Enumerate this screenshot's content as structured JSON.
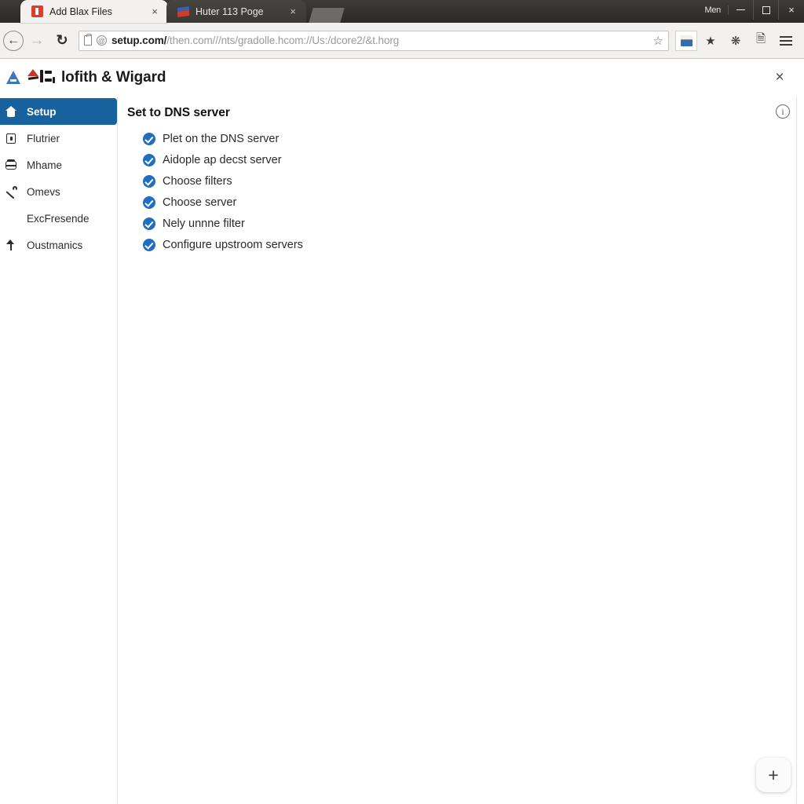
{
  "browser": {
    "tabs": [
      {
        "title": "Add Blax Files",
        "favicon": "red-document-icon",
        "active": true,
        "close_label": "×"
      },
      {
        "title": "Huter 113 Poge",
        "favicon": "flag-icon",
        "active": false,
        "close_label": "×"
      }
    ],
    "window_menu_label": "Men",
    "window_controls": {
      "minimize": "–",
      "maximize": "□",
      "close": "×"
    },
    "nav": {
      "back": "←",
      "forward": "→",
      "reload": "↻"
    },
    "omnibox": {
      "url_host": "setup.com/",
      "url_rest": "/then.com///nts/gradolle.hcom://Us:/dcore2/&t.horg",
      "star": "☆"
    },
    "toolbar_icons": [
      "star-icon",
      "dark-star-icon",
      "puzzle-icon",
      "contact-card-icon",
      "menu-icon"
    ]
  },
  "app": {
    "logo_name": "adguard-logo",
    "title": "lofith & Wigard",
    "close_label": "×"
  },
  "sidebar": {
    "items": [
      {
        "label": "Setup",
        "icon": "home-icon",
        "active": true
      },
      {
        "label": "Flutrier",
        "icon": "lock-icon",
        "active": false
      },
      {
        "label": "Mhame",
        "icon": "database-icon",
        "active": false
      },
      {
        "label": "Omevs",
        "icon": "wrench-icon",
        "active": false
      },
      {
        "label": "ExcFresende",
        "icon": "none",
        "active": false
      },
      {
        "label": "Oustmanics",
        "icon": "up-arrow-icon",
        "active": false
      }
    ]
  },
  "main": {
    "heading": "Set to DNS server",
    "info_icon_label": "i",
    "checklist": [
      {
        "label": "Plet on the DNS server",
        "checked": true
      },
      {
        "label": "Aidople ap decst server",
        "checked": true
      },
      {
        "label": "Choose filters",
        "checked": true
      },
      {
        "label": "Choose server",
        "checked": true
      },
      {
        "label": "Nely unnne filter",
        "checked": true
      },
      {
        "label": "Configure upstroom servers",
        "checked": true
      }
    ],
    "fab_label": "+"
  },
  "colors": {
    "accent_blue": "#18619f",
    "check_blue": "#1f6ec0",
    "titlebar": "#33322f",
    "toolbar": "#f2f1ef"
  }
}
